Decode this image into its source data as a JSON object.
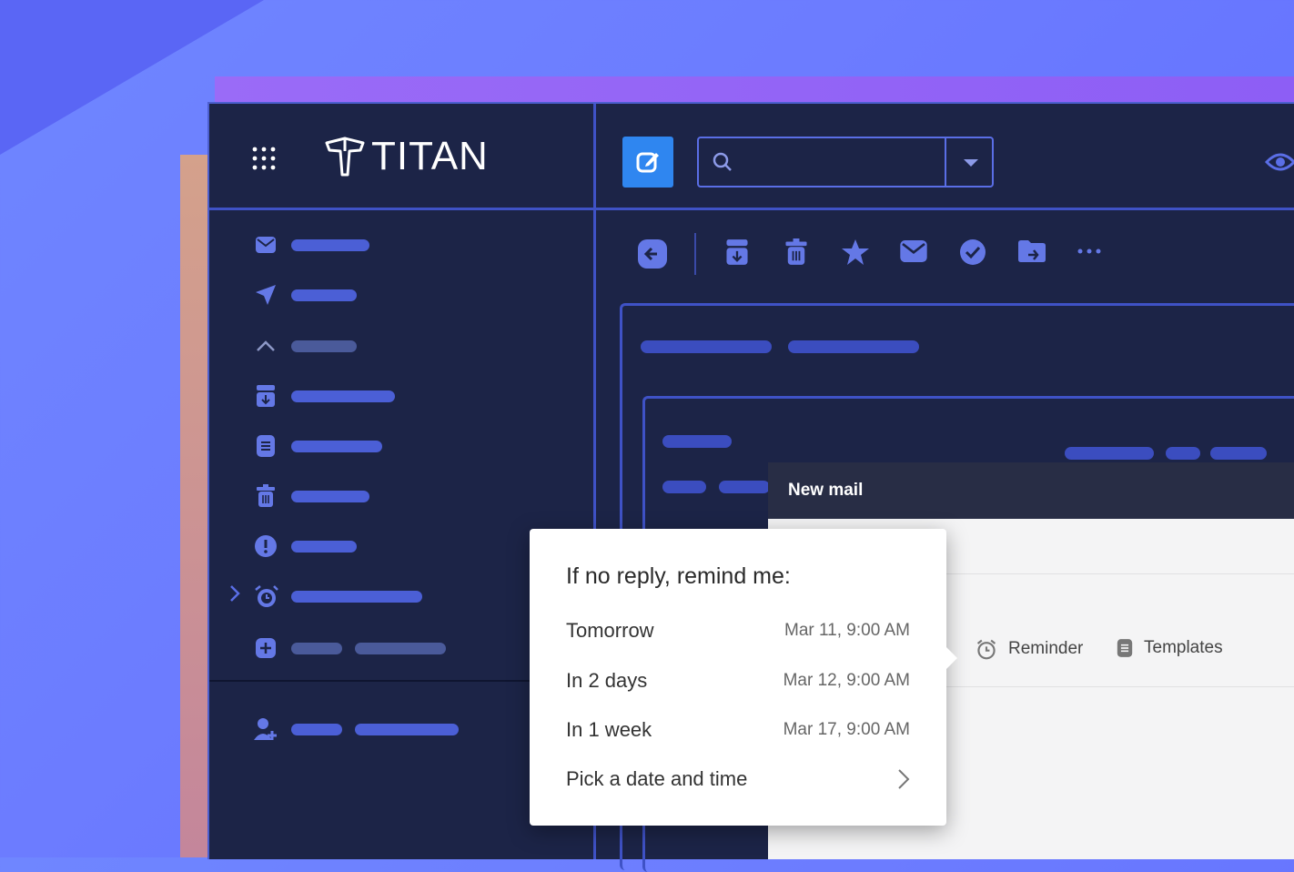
{
  "app": {
    "brand": "TITAN"
  },
  "colors": {
    "accent": "#2f86f0",
    "sidebar_bar": "#4b5fd6",
    "panel_bg": "#1c2447"
  },
  "header": {
    "search": {
      "value": "",
      "placeholder": ""
    }
  },
  "sidebar": {
    "items": [
      {
        "icon": "mail-icon"
      },
      {
        "icon": "send-icon"
      },
      {
        "icon": "chevron-up-icon"
      },
      {
        "icon": "archive-icon"
      },
      {
        "icon": "document-icon"
      },
      {
        "icon": "trash-icon"
      },
      {
        "icon": "alert-icon"
      },
      {
        "icon": "alarm-icon"
      },
      {
        "icon": "plus-box-icon"
      }
    ],
    "footer": {
      "icon": "add-user-icon"
    }
  },
  "toolbar": {
    "icons": [
      "back-icon",
      "archive-icon",
      "trash-icon",
      "star-icon",
      "mail-icon",
      "check-circle-icon",
      "move-folder-icon",
      "more-icon"
    ]
  },
  "compose_window": {
    "title": "New mail",
    "tools": [
      {
        "icon": "alarm-icon",
        "label": "Reminder"
      },
      {
        "icon": "template-icon",
        "label": "Templates"
      }
    ]
  },
  "reminder_popup": {
    "title": "If no reply, remind me:",
    "options": [
      {
        "label": "Tomorrow",
        "datetime": "Mar 11, 9:00 AM"
      },
      {
        "label": "In 2 days",
        "datetime": "Mar 12, 9:00 AM"
      },
      {
        "label": "In 1 week",
        "datetime": "Mar 17, 9:00 AM"
      },
      {
        "label": "Pick a date and time",
        "datetime": ""
      }
    ]
  }
}
